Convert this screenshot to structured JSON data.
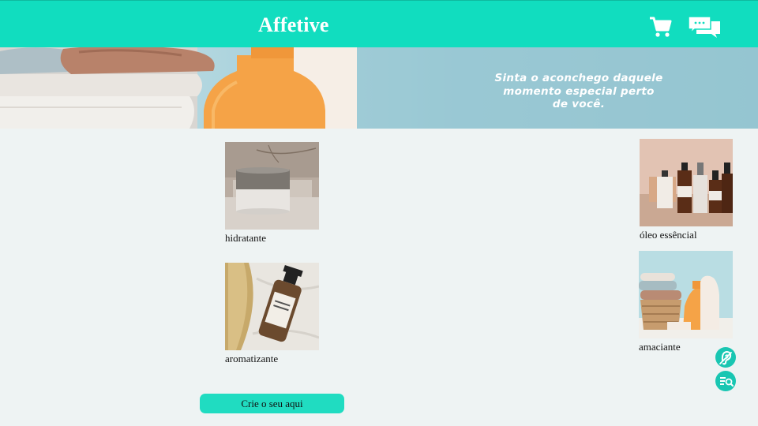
{
  "header": {
    "brand": "Affetive",
    "icons": [
      "cart-icon",
      "chat-icon"
    ]
  },
  "banner": {
    "tagline_lines": [
      "Sinta o aconchego daquele",
      "momento especial perto",
      "de você."
    ]
  },
  "products": [
    {
      "label": "hidratante",
      "image": "cream-jar"
    },
    {
      "label": "aromatizante",
      "image": "spray-bottle"
    },
    {
      "label": "óleo essêncial",
      "image": "oil-bottles"
    },
    {
      "label": "amaciante",
      "image": "softener-towels"
    }
  ],
  "cta": {
    "label": "Crie o seu aqui"
  },
  "floating": [
    "hearing-accessibility-icon",
    "reading-mode-icon"
  ],
  "colors": {
    "header_bg": "#11ddbf",
    "cta_bg": "#20dcc1",
    "fab_bg": "#19c6b2",
    "page_bg": "#eef3f3"
  }
}
